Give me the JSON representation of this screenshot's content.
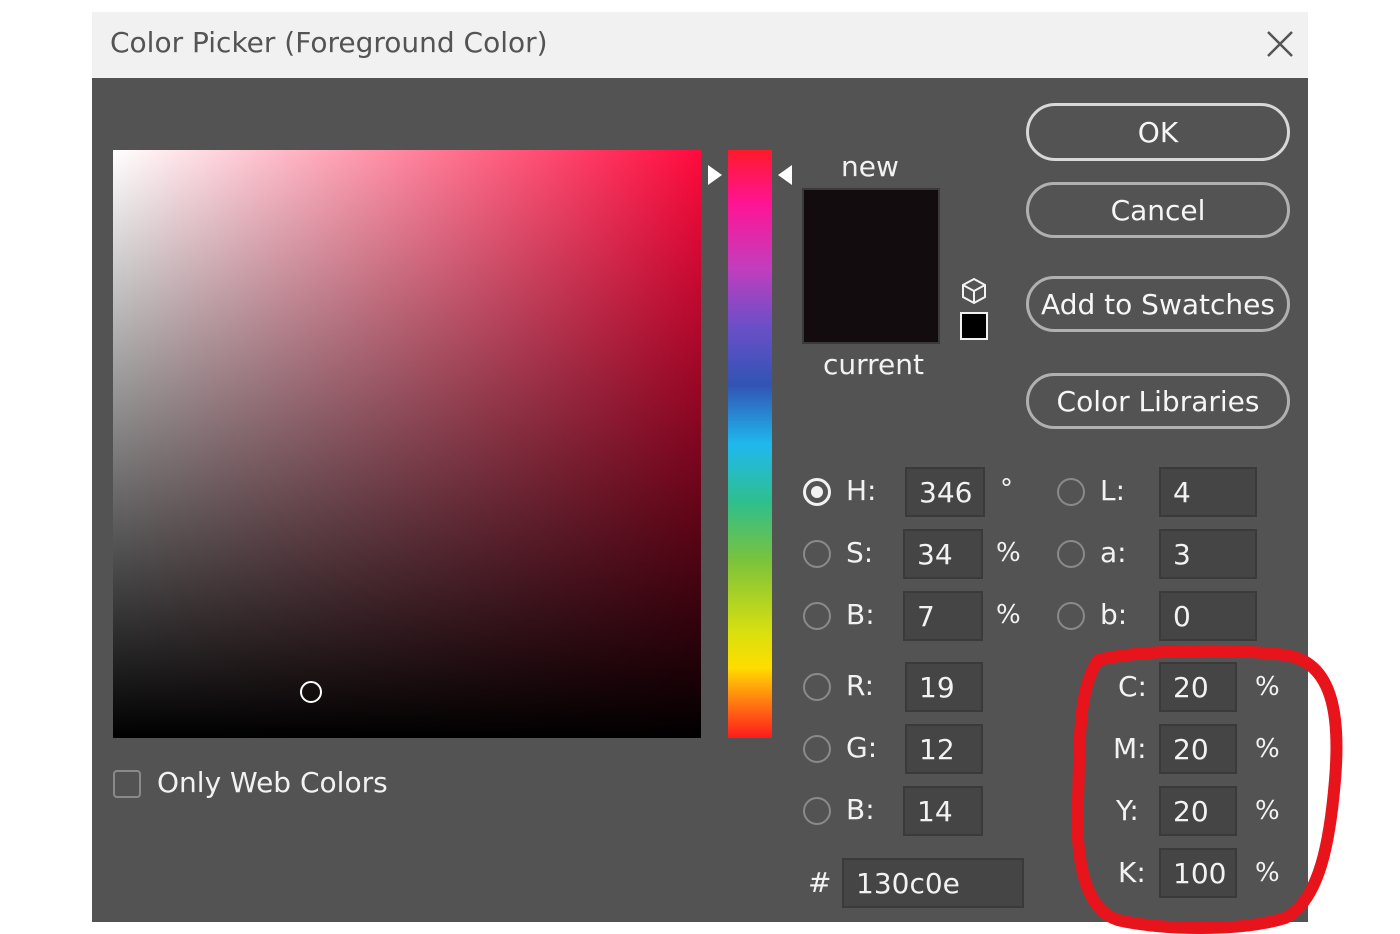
{
  "window": {
    "title": "Color Picker (Foreground Color)"
  },
  "swatch": {
    "new_label": "new",
    "current_label": "current",
    "color": "#130c0e"
  },
  "buttons": {
    "ok": "OK",
    "cancel": "Cancel",
    "add": "Add to Swatches",
    "libraries": "Color Libraries"
  },
  "hsb": [
    {
      "key": "H",
      "label": "H:",
      "value": "346",
      "unit": "°",
      "selected": true
    },
    {
      "key": "S",
      "label": "S:",
      "value": "34",
      "unit": "%",
      "selected": false
    },
    {
      "key": "B",
      "label": "B:",
      "value": "7",
      "unit": "%",
      "selected": false
    }
  ],
  "rgb": [
    {
      "key": "R",
      "label": "R:",
      "value": "19"
    },
    {
      "key": "G",
      "label": "G:",
      "value": "12"
    },
    {
      "key": "B",
      "label": "B:",
      "value": "14"
    }
  ],
  "lab": [
    {
      "key": "L",
      "label": "L:",
      "value": "4"
    },
    {
      "key": "a",
      "label": "a:",
      "value": "3"
    },
    {
      "key": "b",
      "label": "b:",
      "value": "0"
    }
  ],
  "cmyk": [
    {
      "key": "C",
      "label": "C:",
      "value": "20",
      "unit": "%"
    },
    {
      "key": "M",
      "label": "M:",
      "value": "20",
      "unit": "%"
    },
    {
      "key": "Y",
      "label": "Y:",
      "value": "20",
      "unit": "%"
    },
    {
      "key": "K",
      "label": "K:",
      "value": "100",
      "unit": "%"
    }
  ],
  "hex": {
    "label": "#",
    "value": "130c0e"
  },
  "web_colors": {
    "label": "Only Web Colors",
    "checked": false
  },
  "colors": {
    "dialog_bg": "#535353",
    "hue_color": "#ff0a3d",
    "annotation": "#e8141c"
  }
}
